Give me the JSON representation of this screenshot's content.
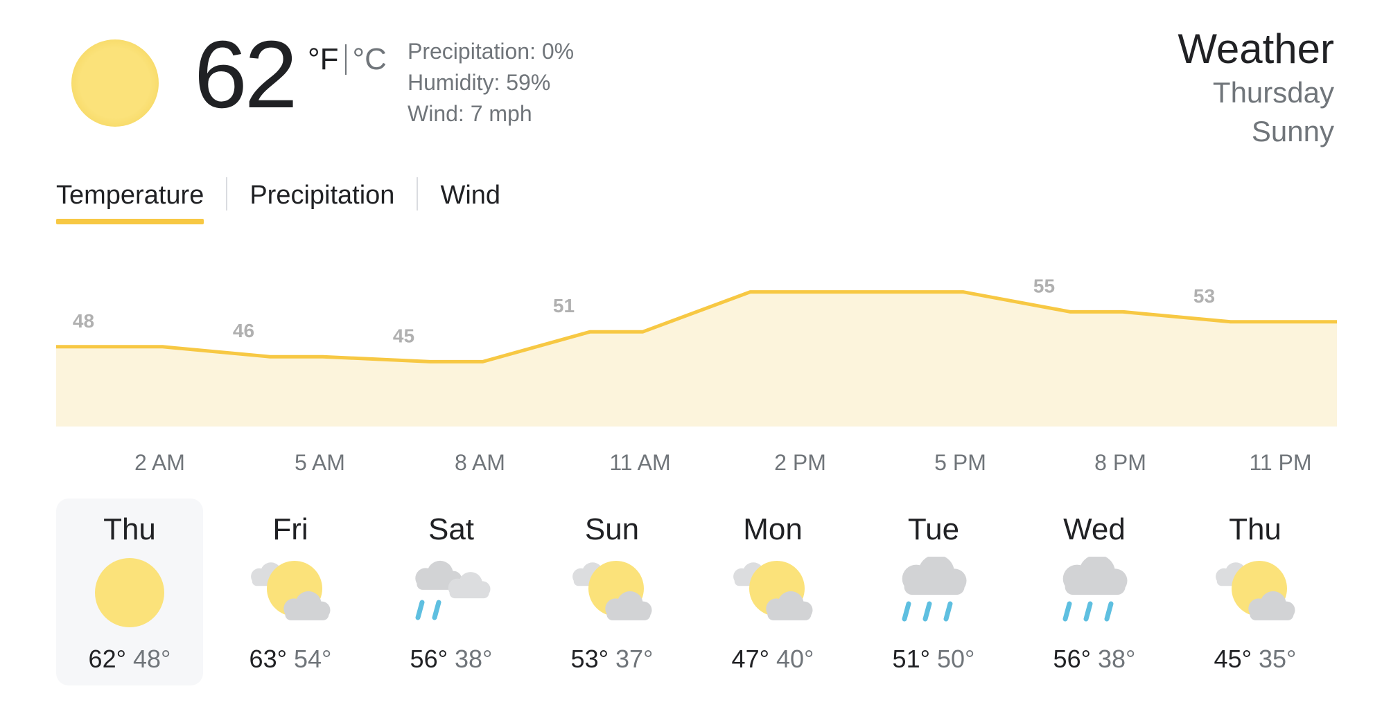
{
  "current": {
    "temperature": "62",
    "unit_f": "°F",
    "unit_c": "°C",
    "icon": "sun-icon",
    "precipitation": "Precipitation: 0%",
    "humidity": "Humidity: 59%",
    "wind": "Wind: 7 mph"
  },
  "header": {
    "title": "Weather",
    "day": "Thursday",
    "condition": "Sunny"
  },
  "tabs": [
    {
      "label": "Temperature",
      "active": true
    },
    {
      "label": "Precipitation",
      "active": false
    },
    {
      "label": "Wind",
      "active": false
    }
  ],
  "colors": {
    "accent": "#f7c843",
    "line": "#f7c843",
    "area": "#fcf4dc",
    "sun": "#fbe27a",
    "cloud": "#d2d3d5",
    "rain": "#5ebfe0",
    "muted_text": "#70757a",
    "chart_label": "#b0b0b0"
  },
  "chart_data": {
    "type": "area",
    "x_labels": [
      "2 AM",
      "5 AM",
      "8 AM",
      "11 AM",
      "2 PM",
      "5 PM",
      "8 PM",
      "11 PM"
    ],
    "values": [
      48,
      46,
      45,
      51,
      59,
      59,
      55,
      53
    ],
    "ylim": [
      32,
      62
    ],
    "grid": false,
    "legend": "none"
  },
  "daily": [
    {
      "day": "Thu",
      "high": "62°",
      "low": "48°",
      "icon": "sun-icon",
      "selected": true
    },
    {
      "day": "Fri",
      "high": "63°",
      "low": "54°",
      "icon": "partly-cloudy-icon",
      "selected": false
    },
    {
      "day": "Sat",
      "high": "56°",
      "low": "38°",
      "icon": "cloudy-showers-icon",
      "selected": false
    },
    {
      "day": "Sun",
      "high": "53°",
      "low": "37°",
      "icon": "partly-cloudy-icon",
      "selected": false
    },
    {
      "day": "Mon",
      "high": "47°",
      "low": "40°",
      "icon": "partly-cloudy-icon",
      "selected": false
    },
    {
      "day": "Tue",
      "high": "51°",
      "low": "50°",
      "icon": "rain-icon",
      "selected": false
    },
    {
      "day": "Wed",
      "high": "56°",
      "low": "38°",
      "icon": "rain-icon",
      "selected": false
    },
    {
      "day": "Thu",
      "high": "45°",
      "low": "35°",
      "icon": "partly-cloudy-icon",
      "selected": false
    }
  ]
}
